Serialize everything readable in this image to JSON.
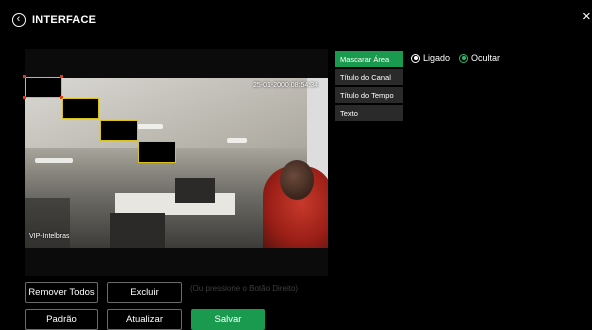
{
  "header": {
    "title": "INTERFACE",
    "back_glyph": "‹",
    "close_glyph": "×"
  },
  "video": {
    "timestamp": "25-01-2000 08:54:34",
    "channel_name": "VIP-Intelbras"
  },
  "menu": {
    "items": [
      {
        "label": "Mascarar Área",
        "active": true
      },
      {
        "label": "Título do Canal",
        "active": false
      },
      {
        "label": "Título do Tempo",
        "active": false
      },
      {
        "label": "Texto",
        "active": false
      }
    ]
  },
  "options": {
    "on_label": "Ligado",
    "hide_label": "Ocultar",
    "selected": "Ocultar"
  },
  "actions": {
    "remove_all": "Remover Todos",
    "delete": "Excluir",
    "hint": "(Ou pressione o Botão Direito)",
    "default": "Padrão",
    "refresh": "Atualizar",
    "save": "Salvar"
  },
  "colors": {
    "accent": "#1a9a4e",
    "mask_border": "#d8c21a",
    "background": "#000000"
  },
  "icons": {
    "back": "back-circle-icon",
    "close": "close-icon"
  }
}
